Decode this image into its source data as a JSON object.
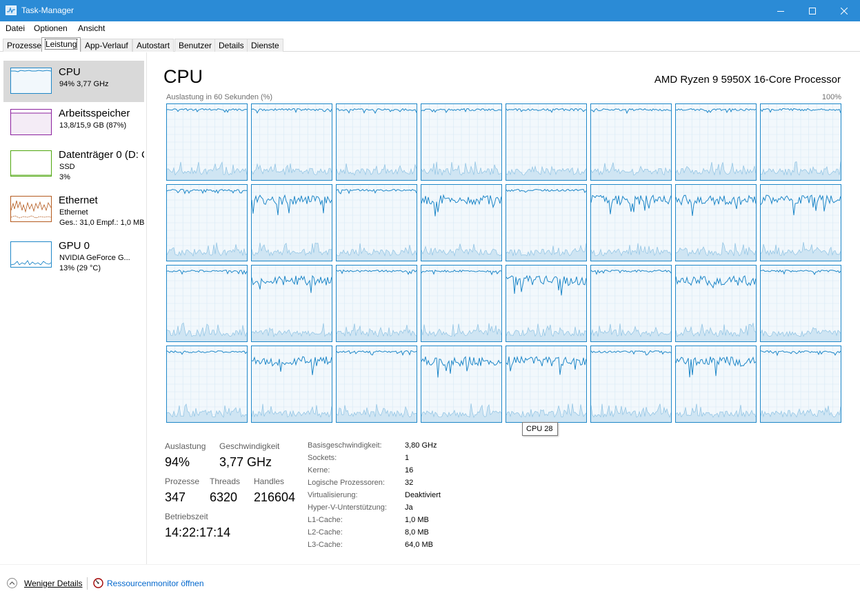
{
  "window": {
    "title": "Task-Manager",
    "icon": "task-manager-icon",
    "accent_color": "#2b8bd6"
  },
  "menu": [
    "Datei",
    "Optionen",
    "Ansicht"
  ],
  "tabs": [
    "Prozesse",
    "Leistung",
    "App-Verlauf",
    "Autostart",
    "Benutzer",
    "Details",
    "Dienste"
  ],
  "active_tab": "Leistung",
  "sidebar": [
    {
      "name": "CPU",
      "line1": "94% 3,77 GHz",
      "line2": "",
      "color": "#1e87c8",
      "selected": true
    },
    {
      "name": "Arbeitsspeicher",
      "line1": "13,8/15,9 GB (87%)",
      "line2": "",
      "color": "#8b1f9e",
      "selected": false
    },
    {
      "name": "Datenträger 0 (D: C",
      "line1": "SSD",
      "line2": "3%",
      "color": "#4da60c",
      "selected": false
    },
    {
      "name": "Ethernet",
      "line1": "Ethernet",
      "line2": "Ges.: 31,0 Empf.: 1,0 MB",
      "color": "#b45a1e",
      "selected": false
    },
    {
      "name": "GPU 0",
      "line1": "NVIDIA GeForce G...",
      "line2": "13% (29 °C)",
      "color": "#1e87c8",
      "selected": false
    }
  ],
  "main": {
    "heading": "CPU",
    "processor": "AMD Ryzen 9 5950X 16-Core Processor",
    "graph_caption": "Auslastung in 60 Sekunden (%)",
    "graph_max": "100%",
    "graph_color": "#1e87c8",
    "logical_processor_graph_count": 32,
    "tooltip": "CPU 28"
  },
  "stats": {
    "auslastung_label": "Auslastung",
    "auslastung": "94%",
    "geschwindigkeit_label": "Geschwindigkeit",
    "geschwindigkeit": "3,77 GHz",
    "prozesse_label": "Prozesse",
    "prozesse": "347",
    "threads_label": "Threads",
    "threads": "6320",
    "handles_label": "Handles",
    "handles": "216604",
    "betriebszeit_label": "Betriebszeit",
    "betriebszeit": "14:22:17:14"
  },
  "info": [
    {
      "label": "Basisgeschwindigkeit:",
      "value": "3,80 GHz"
    },
    {
      "label": "Sockets:",
      "value": "1"
    },
    {
      "label": "Kerne:",
      "value": "16"
    },
    {
      "label": "Logische Prozessoren:",
      "value": "32"
    },
    {
      "label": "Virtualisierung:",
      "value": "Deaktiviert"
    },
    {
      "label": "Hyper-V-Unterstützung:",
      "value": "Ja"
    },
    {
      "label": "L1-Cache:",
      "value": "1,0 MB"
    },
    {
      "label": "L2-Cache:",
      "value": "8,0 MB"
    },
    {
      "label": "L3-Cache:",
      "value": "64,0 MB"
    }
  ],
  "footer": {
    "less_details": "Weniger Details",
    "resource_monitor": "Ressourcenmonitor öffnen"
  }
}
